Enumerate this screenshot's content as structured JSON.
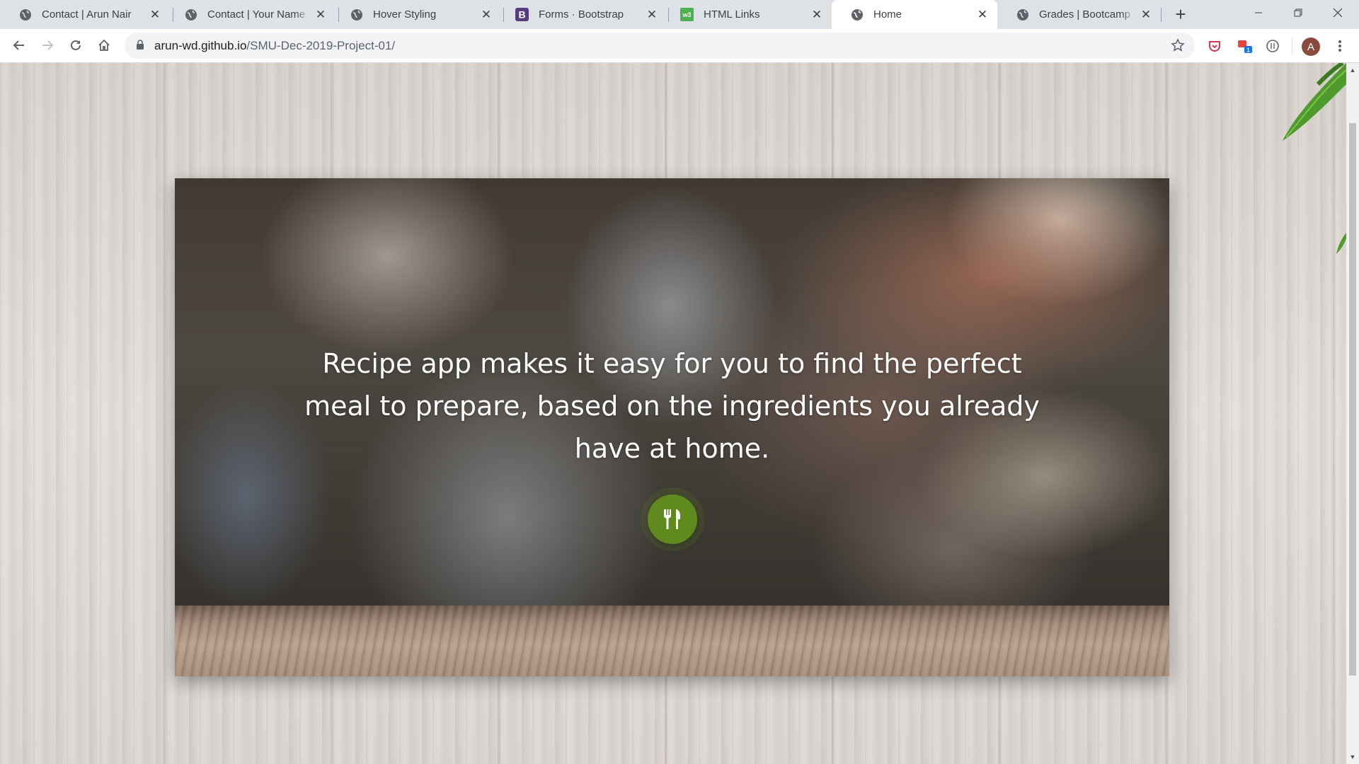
{
  "browser": {
    "tabs": [
      {
        "title": "Contact | Arun Nair",
        "icon": "globe-icon",
        "active": false
      },
      {
        "title": "Contact | Your Name",
        "icon": "globe-icon",
        "active": false
      },
      {
        "title": "Hover Styling",
        "icon": "globe-icon",
        "active": false
      },
      {
        "title": "Forms · Bootstrap",
        "icon": "bootstrap-icon",
        "active": false
      },
      {
        "title": "HTML Links",
        "icon": "w3schools-icon",
        "active": false
      },
      {
        "title": "Home",
        "icon": "globe-icon",
        "active": true
      },
      {
        "title": "Grades | Bootcamp Spot",
        "icon": "globe-icon",
        "active": false
      }
    ],
    "url": {
      "host": "arun-wd.github.io",
      "path": "/SMU-Dec-2019-Project-01/"
    },
    "avatar_letter": "A",
    "extension_badge": "1"
  },
  "page": {
    "hero_text": "Recipe app makes it easy for you to find the perfect meal to prepare, based on the ingredients you already have at home.",
    "button_icon": "utensils-icon",
    "accent_color": "#5e8a1e"
  }
}
